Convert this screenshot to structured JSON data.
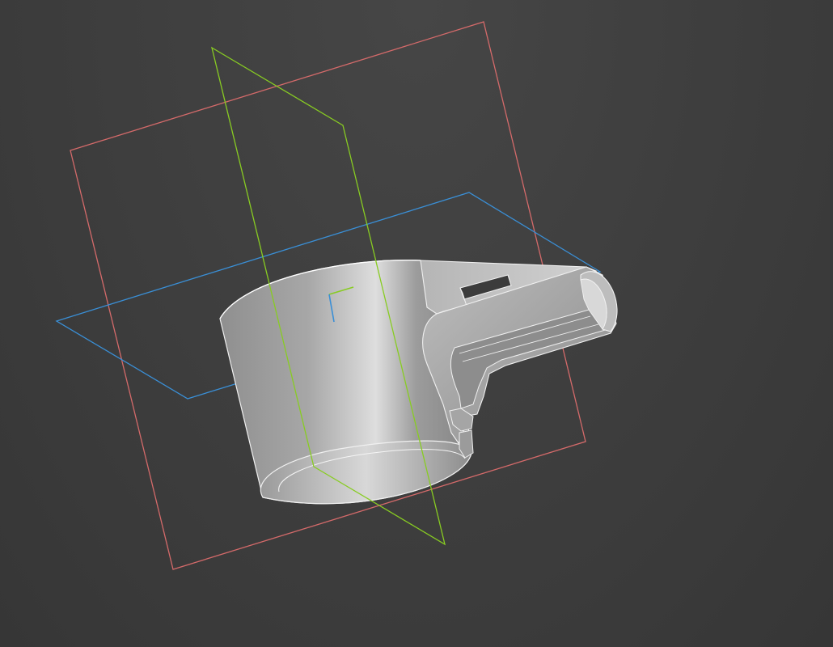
{
  "viewport": {
    "background": "#404040"
  },
  "colors": {
    "front_plane": "#d46a6a",
    "right_plane": "#88cc22",
    "top_plane": "#3a8fd6",
    "model_edge": "#f2f2f2",
    "model_body_light": "#d6d6d6",
    "model_body_dark": "#7c7c7c",
    "origin_x": "#88cc22",
    "origin_y": "#3a8fd6"
  },
  "icons": {
    "origin": "origin-triad-icon"
  }
}
